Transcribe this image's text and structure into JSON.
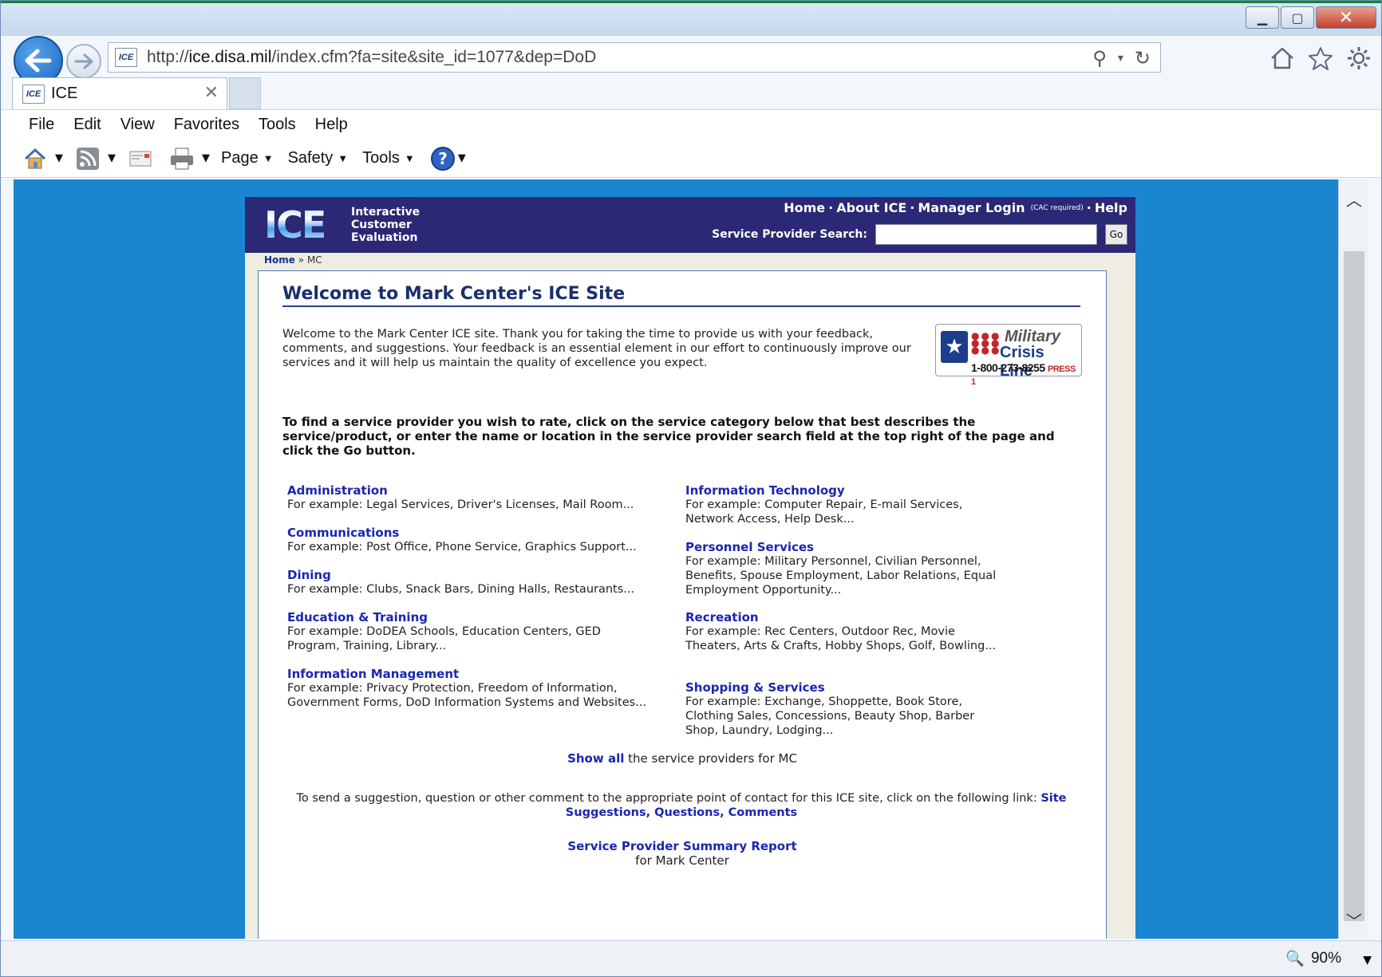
{
  "browser": {
    "url_prefix": "http://",
    "url_host": "ice.disa.mil",
    "url_path": "/index.cfm?fa=site&site_id=1077&dep=DoD",
    "site_icon": "ICE",
    "tab_label": "ICE",
    "tab_close": "✕",
    "menu": [
      "File",
      "Edit",
      "View",
      "Favorites",
      "Tools",
      "Help"
    ],
    "command_bar": {
      "page": "Page",
      "safety": "Safety",
      "tools": "Tools"
    },
    "zoom": "90%"
  },
  "site": {
    "logo": "ICE",
    "title_lines": [
      "Interactive",
      "Customer",
      "Evaluation"
    ],
    "nav": {
      "home": "Home",
      "about": "About ICE",
      "manager": "Manager Login",
      "cac_note": "(CAC required)",
      "help": "Help",
      "sep": "·"
    },
    "search": {
      "label": "Service Provider Search:",
      "value": "",
      "go": "Go"
    },
    "breadcrumb": {
      "home": "Home",
      "sep": "»",
      "current": "MC"
    }
  },
  "main": {
    "welcome_title": "Welcome to Mark Center's ICE Site",
    "intro": "Welcome to the Mark Center ICE site. Thank you for taking the time to provide us with your feedback, comments, and suggestions. Your feedback is an essential element in our effort to continuously improve our services and it will help us maintain the quality of excellence you expect.",
    "crisis": {
      "military": "Military",
      "line": "Crisis Line",
      "phone": "1-800-273-8255",
      "press": "PRESS 1"
    },
    "instructions": "To find a service provider you wish to rate, click on the service category below that best describes the service/product, or enter the name or location in the service provider search field at the top right of the page and click the Go button.",
    "categories_left": [
      {
        "title": "Administration",
        "desc": "For example: Legal Services, Driver's Licenses, Mail Room..."
      },
      {
        "title": "Communications",
        "desc": "For example: Post Office, Phone Service, Graphics Support..."
      },
      {
        "title": "Dining",
        "desc": "For example: Clubs, Snack Bars, Dining Halls, Restaurants..."
      },
      {
        "title": "Education & Training",
        "desc": "For example: DoDEA Schools, Education Centers, GED Program, Training, Library..."
      },
      {
        "title": "Information Management",
        "desc": "For example: Privacy Protection, Freedom of Information, Government Forms, DoD Information Systems and Websites..."
      }
    ],
    "categories_right": [
      {
        "title": "Information Technology",
        "desc": "For example: Computer Repair, E-mail Services, Network Access, Help Desk..."
      },
      {
        "title": "Personnel Services",
        "desc": "For example: Military Personnel, Civilian Personnel, Benefits, Spouse Employment, Labor Relations, Equal Employment Opportunity..."
      },
      {
        "title": "Recreation",
        "desc": "For example: Rec Centers, Outdoor Rec, Movie Theaters, Arts & Crafts, Hobby Shops, Golf, Bowling..."
      },
      {
        "title": "Shopping & Services",
        "desc": "For example: Exchange, Shoppette, Book Store, Clothing Sales, Concessions, Beauty Shop, Barber Shop, Laundry, Lodging..."
      }
    ],
    "show_all_link": "Show all",
    "show_all_text": "the service providers for MC",
    "suggest_text": "To send a suggestion, question or other comment to the appropriate point of contact for this ICE site, click on the following link:",
    "suggest_link": "Site Suggestions, Questions, Comments",
    "report_link": "Service Provider Summary Report",
    "report_text": "for Mark Center"
  },
  "colors": {
    "page_bg": "#1a86d0",
    "header": "#2b2875",
    "link": "#1a26b0"
  },
  "icons": [
    "back-icon",
    "forward-icon",
    "search-icon",
    "refresh-icon",
    "home-icon",
    "favorites-star-icon",
    "settings-gear-icon",
    "rss-feed-icon",
    "mail-icon",
    "print-icon",
    "help-icon",
    "zoom-icon",
    "minimize-icon",
    "maximize-icon",
    "close-icon"
  ]
}
